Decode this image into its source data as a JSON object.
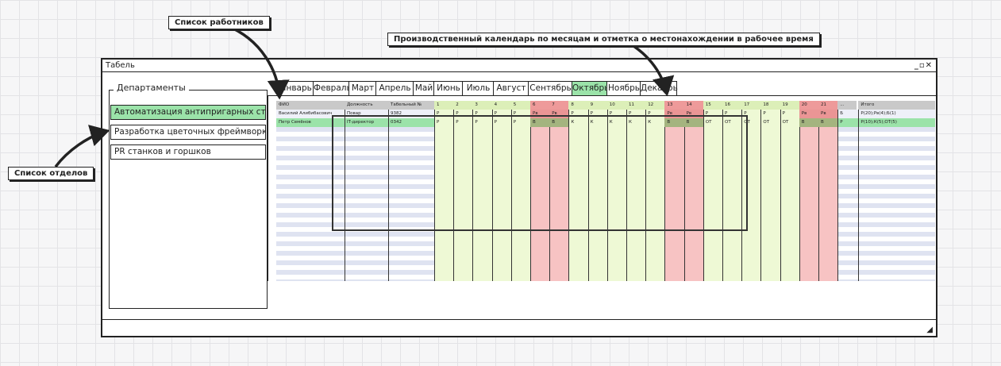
{
  "callouts": {
    "employees": "Список работников",
    "calendar": "Производственный календарь по месяцам и отметка о местонахождении в рабочее время",
    "departments": "Список отделов"
  },
  "window": {
    "title": "Табель",
    "controls": "_▫✕"
  },
  "departments": {
    "title": "Департаменты",
    "items": [
      {
        "label": "Автоматизация антипригарных стульев",
        "active": true
      },
      {
        "label": "Разработка цветочных фреймворков",
        "active": false
      },
      {
        "label": "PR станков и горшков",
        "active": false
      }
    ]
  },
  "tabs": [
    {
      "label": "Январь"
    },
    {
      "label": "Февраль"
    },
    {
      "label": "Март"
    },
    {
      "label": "Апрель"
    },
    {
      "label": "Май"
    },
    {
      "label": "Июнь"
    },
    {
      "label": "Июль"
    },
    {
      "label": "Август"
    },
    {
      "label": "Сентябрь"
    },
    {
      "label": "Октябрь",
      "active": true
    },
    {
      "label": "Ноябрь"
    },
    {
      "label": "Декабрь"
    }
  ],
  "table": {
    "headers": {
      "name": "ФИО",
      "position": "Должность",
      "tab_number": "Табельный №",
      "days": [
        "1",
        "2",
        "3",
        "4",
        "5",
        "6",
        "7",
        "8",
        "9",
        "10",
        "11",
        "12",
        "13",
        "14",
        "15",
        "16",
        "17",
        "18",
        "19",
        "20",
        "21",
        "..."
      ],
      "total": "Итого"
    },
    "day_types": [
      "w",
      "w",
      "w",
      "w",
      "w",
      "h",
      "h",
      "w",
      "w",
      "w",
      "w",
      "w",
      "h",
      "h",
      "w",
      "w",
      "w",
      "w",
      "w",
      "h",
      "h",
      "x"
    ],
    "rows": [
      {
        "name": "Василий Алибибасович",
        "position": "Повар",
        "tab_number": "9382",
        "marks": [
          "Р",
          "Р",
          "Р",
          "Р",
          "Р",
          "Рв",
          "Рв",
          "Р",
          "Р",
          "Р",
          "Р",
          "Р",
          "Рв",
          "Рв",
          "Р",
          "Р",
          "Р",
          "Р",
          "Р",
          "Рв",
          "Рв",
          "Б"
        ],
        "total": "Р(20);Рв(4);Б(1)"
      },
      {
        "name": "Петр Семёнов",
        "position": "IT-директор",
        "tab_number": "0342",
        "marks": [
          "Р",
          "Р",
          "Р",
          "Р",
          "Р",
          "В",
          "В",
          "К",
          "К",
          "К",
          "К",
          "К",
          "В",
          "В",
          "ОТ",
          "ОТ",
          "ОТ",
          "ОТ",
          "ОТ",
          "В",
          "В",
          "Р"
        ],
        "total": "Р(10);К(5);ОТ(5)"
      }
    ]
  }
}
